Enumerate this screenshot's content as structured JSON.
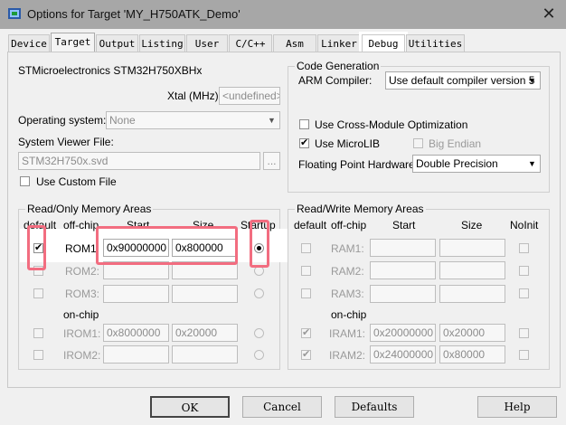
{
  "window": {
    "title": "Options for Target 'MY_H750ATK_Demo'",
    "close_glyph": "✕"
  },
  "tabs": [
    {
      "label": "Device"
    },
    {
      "label": "Target"
    },
    {
      "label": "Output"
    },
    {
      "label": "Listing"
    },
    {
      "label": "User"
    },
    {
      "label": "C/C++"
    },
    {
      "label": "Asm"
    },
    {
      "label": "Linker"
    },
    {
      "label": "Debug"
    },
    {
      "label": "Utilities"
    }
  ],
  "target": {
    "device_name": "STMicroelectronics STM32H750XBHx",
    "xtal_label": "Xtal (MHz):",
    "xtal_value": "<undefined>",
    "os_label": "Operating system:",
    "os_value": "None",
    "svf_label": "System Viewer File:",
    "svf_value": "STM32H750x.svd",
    "svf_browse": "...",
    "custom_file_label": "Use Custom File"
  },
  "code_gen": {
    "title": "Code Generation",
    "compiler_label": "ARM Compiler:",
    "compiler_value": "Use default compiler version 5",
    "cross_module_label": "Use Cross-Module Optimization",
    "microlib_label": "Use MicroLIB",
    "microlib_check": "✔",
    "big_endian_label": "Big Endian",
    "fp_label": "Floating Point Hardware:",
    "fp_value": "Double Precision",
    "dropdown_glyph": "▼"
  },
  "ro_mem": {
    "title": "Read/Only Memory Areas",
    "headers": {
      "default": "default",
      "offchip": "off-chip",
      "start": "Start",
      "size": "Size",
      "startup": "Startup"
    },
    "onchip_label": "on-chip",
    "rows": [
      {
        "name": "ROM1:",
        "start": "0x90000000",
        "size": "0x800000",
        "checked": "✔"
      },
      {
        "name": "ROM2:",
        "start": "",
        "size": ""
      },
      {
        "name": "ROM3:",
        "start": "",
        "size": ""
      },
      {
        "name": "IROM1:",
        "start": "0x8000000",
        "size": "0x20000"
      },
      {
        "name": "IROM2:",
        "start": "",
        "size": ""
      }
    ]
  },
  "rw_mem": {
    "title": "Read/Write Memory Areas",
    "headers": {
      "default": "default",
      "offchip": "off-chip",
      "start": "Start",
      "size": "Size",
      "noinit": "NoInit"
    },
    "onchip_label": "on-chip",
    "rows": [
      {
        "name": "RAM1:",
        "start": "",
        "size": ""
      },
      {
        "name": "RAM2:",
        "start": "",
        "size": ""
      },
      {
        "name": "RAM3:",
        "start": "",
        "size": ""
      },
      {
        "name": "IRAM1:",
        "start": "0x20000000",
        "size": "0x20000",
        "checked": "✔"
      },
      {
        "name": "IRAM2:",
        "start": "0x24000000",
        "size": "0x80000",
        "checked": "✔"
      }
    ]
  },
  "buttons": {
    "ok": "OK",
    "cancel": "Cancel",
    "defaults": "Defaults",
    "help": "Help"
  },
  "colors": {
    "highlight": "#f26d80",
    "titlebar": "#a7a7a7"
  }
}
